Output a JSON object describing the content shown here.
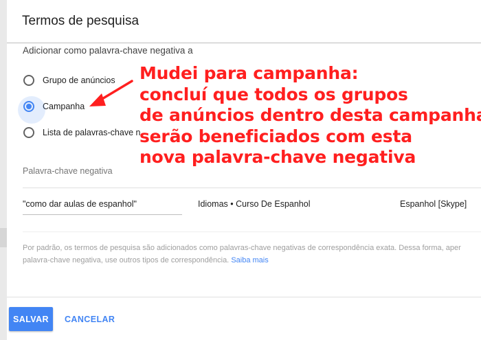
{
  "dialog": {
    "title": "Termos de pesquisa",
    "add_as_label": "Adicionar como palavra-chave negativa a",
    "options": [
      {
        "label": "Grupo de anúncios",
        "selected": false
      },
      {
        "label": "Campanha",
        "selected": true
      },
      {
        "label": "Lista de palavras-chave n",
        "selected": false
      }
    ],
    "negative_keyword_label": "Palavra-chave negativa",
    "row": {
      "keyword": "\"como dar aulas de espanhol\"",
      "ad_group": "Idiomas • Curso De Espanhol",
      "campaign": "Espanhol [Skype]"
    },
    "help_line_1": "Por padrão, os termos de pesquisa são adicionados como palavras-chave negativas de correspondência exata. Dessa forma, aper",
    "help_line_2": "palavra-chave negativa, use outros tipos de correspondência.",
    "help_link": "Saiba mais",
    "save_label": "SALVAR",
    "cancel_label": "CANCELAR"
  },
  "annotation": {
    "lines": [
      "Mudei para campanha:",
      "concluí que todos os grupos",
      "de anúncios dentro desta campanha",
      "serão beneficiados com esta",
      "nova palavra-chave negativa"
    ],
    "color": "#ff1f1f"
  },
  "colors": {
    "accent": "#4285f4"
  }
}
